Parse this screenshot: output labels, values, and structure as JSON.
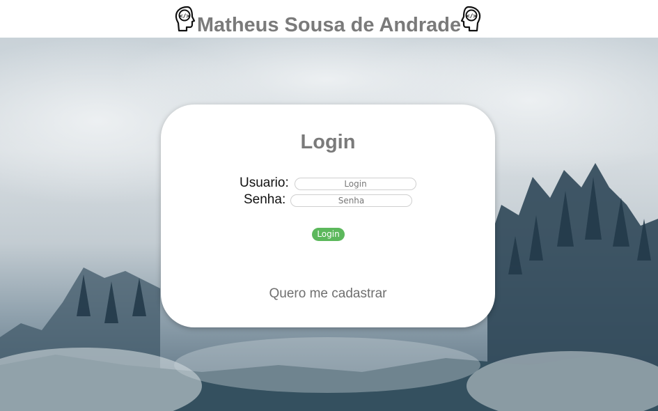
{
  "header": {
    "title": "Matheus Sousa de Andrade",
    "icons": [
      "developer-head-icon",
      "developer-head-icon"
    ]
  },
  "login_card": {
    "title": "Login",
    "username": {
      "label": "Usuario:",
      "placeholder": "Login",
      "value": ""
    },
    "password": {
      "label": "Senha:",
      "placeholder": "Senha",
      "value": ""
    },
    "submit_label": "Login",
    "register_link": "Quero me cadastrar"
  },
  "colors": {
    "title_gray": "#7a7a7a",
    "button_green": "#5cb85c",
    "card_bg": "#ffffff"
  }
}
